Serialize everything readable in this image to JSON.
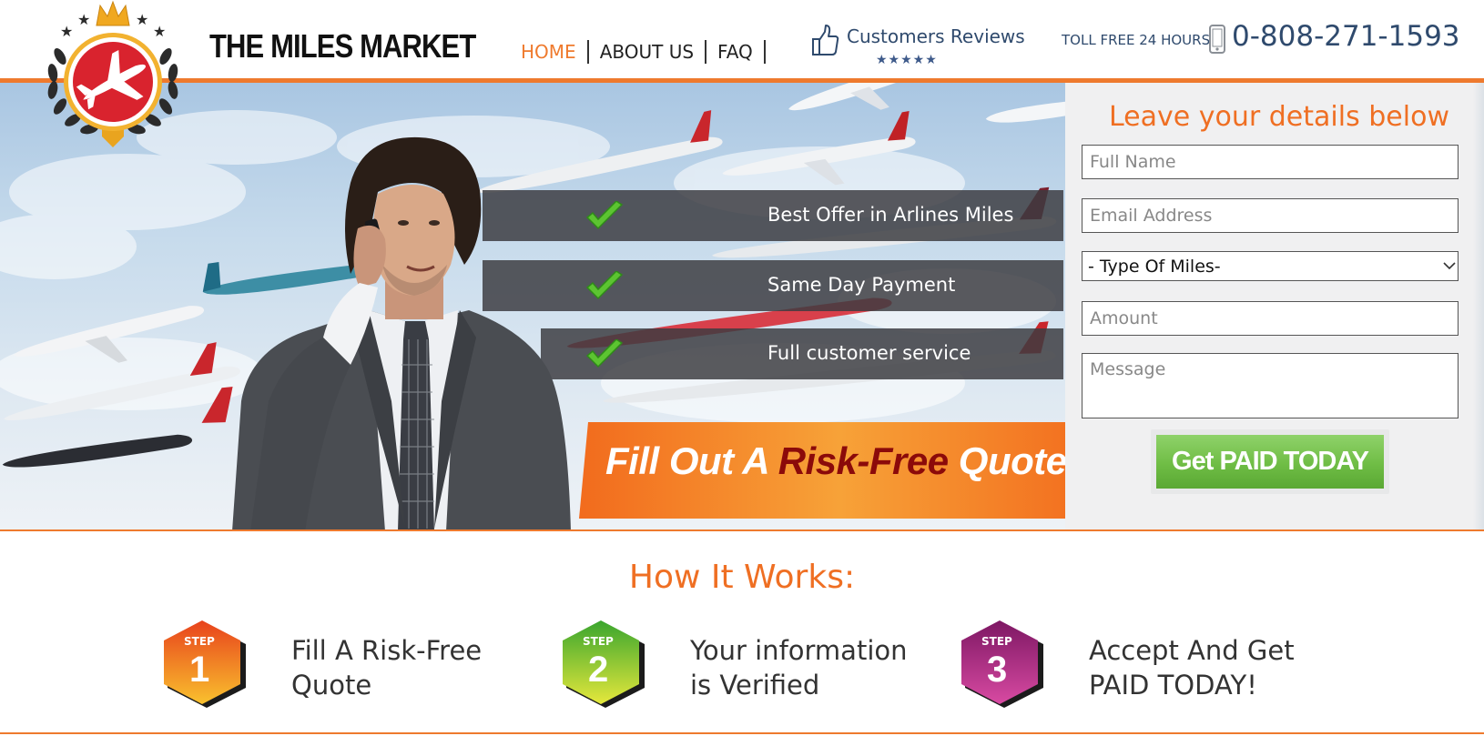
{
  "brand": {
    "name": "THE MILES MARKET"
  },
  "nav": {
    "items": [
      {
        "label": "HOME",
        "active": true
      },
      {
        "label": "ABOUT US",
        "active": false
      },
      {
        "label": "FAQ",
        "active": false
      }
    ]
  },
  "reviews": {
    "label": "Customers Reviews",
    "stars": "★★★★★",
    "rating": 5
  },
  "contact": {
    "tollfree_label": "TOLL FREE 24 HOURS",
    "phone": "0-808-271-1593"
  },
  "hero": {
    "benefits": [
      {
        "label": "Best Offer in Arlines Miles"
      },
      {
        "label": "Same Day Payment"
      },
      {
        "label": "Full customer service"
      }
    ],
    "cta": {
      "part1": "Fill Out A ",
      "highlight": "Risk-Free",
      "part2": " Quote"
    }
  },
  "form": {
    "title": "Leave your details below",
    "name_placeholder": "Full Name",
    "email_placeholder": "Email Address",
    "type_selected": "- Type Of Miles-",
    "amount_placeholder": "Amount",
    "message_placeholder": "Message",
    "submit_label": "Get PAID TODAY"
  },
  "how": {
    "title": "How It Works:",
    "step_word": "STEP",
    "steps": [
      {
        "number": "1",
        "line1": "Fill A Risk-Free",
        "line2": "Quote",
        "color": "#f07a1f"
      },
      {
        "number": "2",
        "line1": "Your information",
        "line2": "is Verified",
        "color": "#6fbd2b"
      },
      {
        "number": "3",
        "line1": "Accept And Get",
        "line2": "PAID TODAY!",
        "color": "#b1237a"
      }
    ]
  },
  "colors": {
    "accent": "#ee7a2e",
    "navy": "#2f4a6d",
    "cta_green": "#6fbd45",
    "cta_highlight": "#8b0a0a"
  }
}
